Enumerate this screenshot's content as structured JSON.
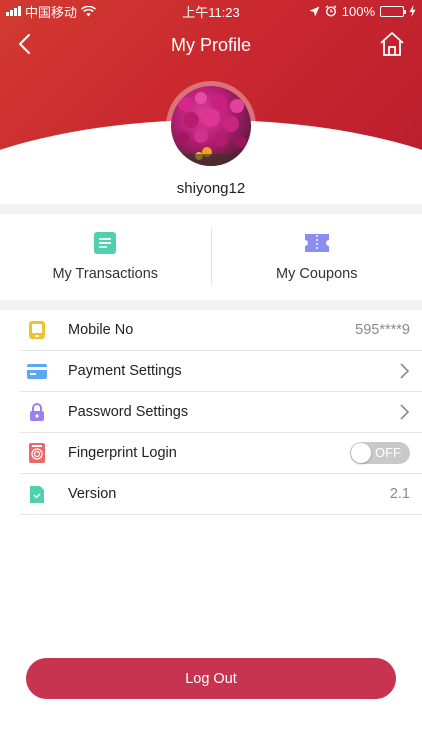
{
  "status_bar": {
    "carrier": "中国移动",
    "time": "上午11:23",
    "battery_percent": "100%",
    "battery_color": "#4cd964"
  },
  "nav": {
    "title": "My Profile",
    "back_icon": "chevron-left-icon",
    "home_icon": "home-icon"
  },
  "profile": {
    "username": "shiyong12"
  },
  "quick_actions": [
    {
      "label": "My Transactions",
      "icon": "document-icon",
      "color": "#4fd1b0"
    },
    {
      "label": "My Coupons",
      "icon": "ticket-icon",
      "color": "#8a8ef0"
    }
  ],
  "settings": [
    {
      "label": "Mobile No",
      "value": "595****9",
      "icon": "phone-icon",
      "color": "#f2c12e"
    },
    {
      "label": "Payment Settings",
      "icon": "card-icon",
      "color": "#5aa9f0",
      "chevron": true
    },
    {
      "label": "Password Settings",
      "icon": "lock-icon",
      "color": "#9b7ef0",
      "chevron": true
    },
    {
      "label": "Fingerprint Login",
      "icon": "fingerprint-icon",
      "color": "#e86a6a",
      "toggle": "OFF"
    },
    {
      "label": "Version",
      "value": "2.1",
      "icon": "file-icon",
      "color": "#4fd1b0"
    }
  ],
  "logout_label": "Log Out",
  "colors": {
    "header": "#c9282f",
    "logout": "#c8334f"
  }
}
